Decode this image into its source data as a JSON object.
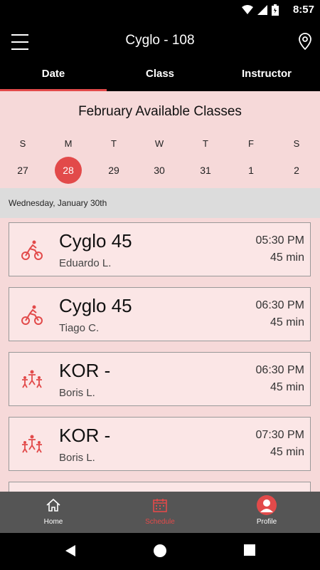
{
  "status_bar": {
    "time": "8:57"
  },
  "app_bar": {
    "title": "Cyglo - 108"
  },
  "tabs": [
    {
      "label": "Date",
      "active": true
    },
    {
      "label": "Class",
      "active": false
    },
    {
      "label": "Instructor",
      "active": false
    }
  ],
  "calendar": {
    "title": "February Available Classes",
    "weekdays": [
      "S",
      "M",
      "T",
      "W",
      "T",
      "F",
      "S"
    ],
    "dates": [
      "27",
      "28",
      "29",
      "30",
      "31",
      "1",
      "2"
    ],
    "selected_index": 1
  },
  "day_header": "Wednesday, January 30th",
  "classes": [
    {
      "name": "Cyglo 45",
      "instructor": "Eduardo L.",
      "time": "05:30 PM",
      "duration": "45 min",
      "icon": "cycling-icon"
    },
    {
      "name": "Cyglo 45",
      "instructor": "Tiago C.",
      "time": "06:30 PM",
      "duration": "45 min",
      "icon": "cycling-icon"
    },
    {
      "name": "KOR -",
      "instructor": "Boris L.",
      "time": "06:30 PM",
      "duration": "45 min",
      "icon": "group-fitness-icon"
    },
    {
      "name": "KOR -",
      "instructor": "Boris L.",
      "time": "07:30 PM",
      "duration": "45 min",
      "icon": "group-fitness-icon"
    }
  ],
  "bottom_nav": [
    {
      "label": "Home",
      "icon": "home-icon",
      "active": false
    },
    {
      "label": "Schedule",
      "icon": "calendar-icon",
      "active": true
    },
    {
      "label": "Profile",
      "icon": "profile-icon",
      "active": false
    }
  ],
  "colors": {
    "accent": "#e24a4a",
    "bar": "#000000",
    "nav": "#555555"
  }
}
